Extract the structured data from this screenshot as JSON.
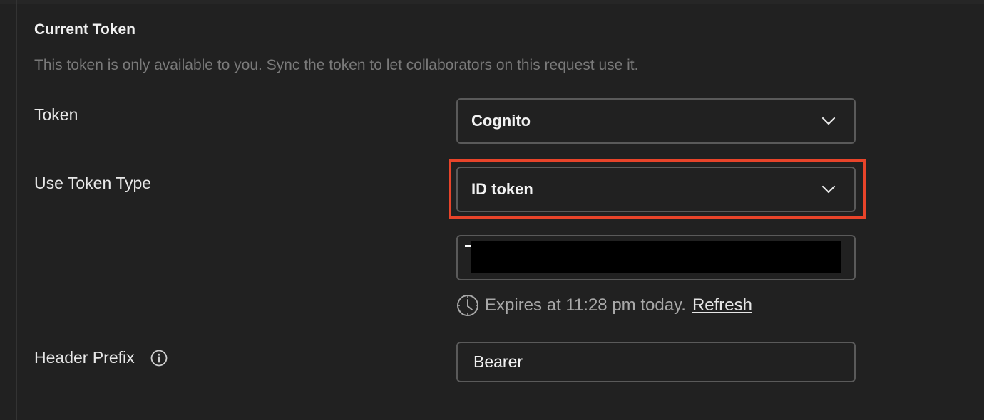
{
  "section": {
    "title": "Current Token",
    "description": "This token is only available to you. Sync the token to let collaborators on this request use it."
  },
  "token": {
    "label": "Token",
    "selected": "Cognito"
  },
  "token_type": {
    "label": "Use Token Type",
    "selected": "ID token"
  },
  "token_value": {
    "redacted": true
  },
  "expiry": {
    "text": "Expires at 11:28 pm today.",
    "refresh_label": "Refresh"
  },
  "header_prefix": {
    "label": "Header Prefix",
    "value": "Bearer"
  },
  "colors": {
    "background": "#212121",
    "border": "#5a5a5a",
    "highlight": "#e8442a",
    "muted_text": "#7a7a7a"
  },
  "icons": [
    "chevron-down-icon",
    "clock-icon",
    "info-icon"
  ]
}
